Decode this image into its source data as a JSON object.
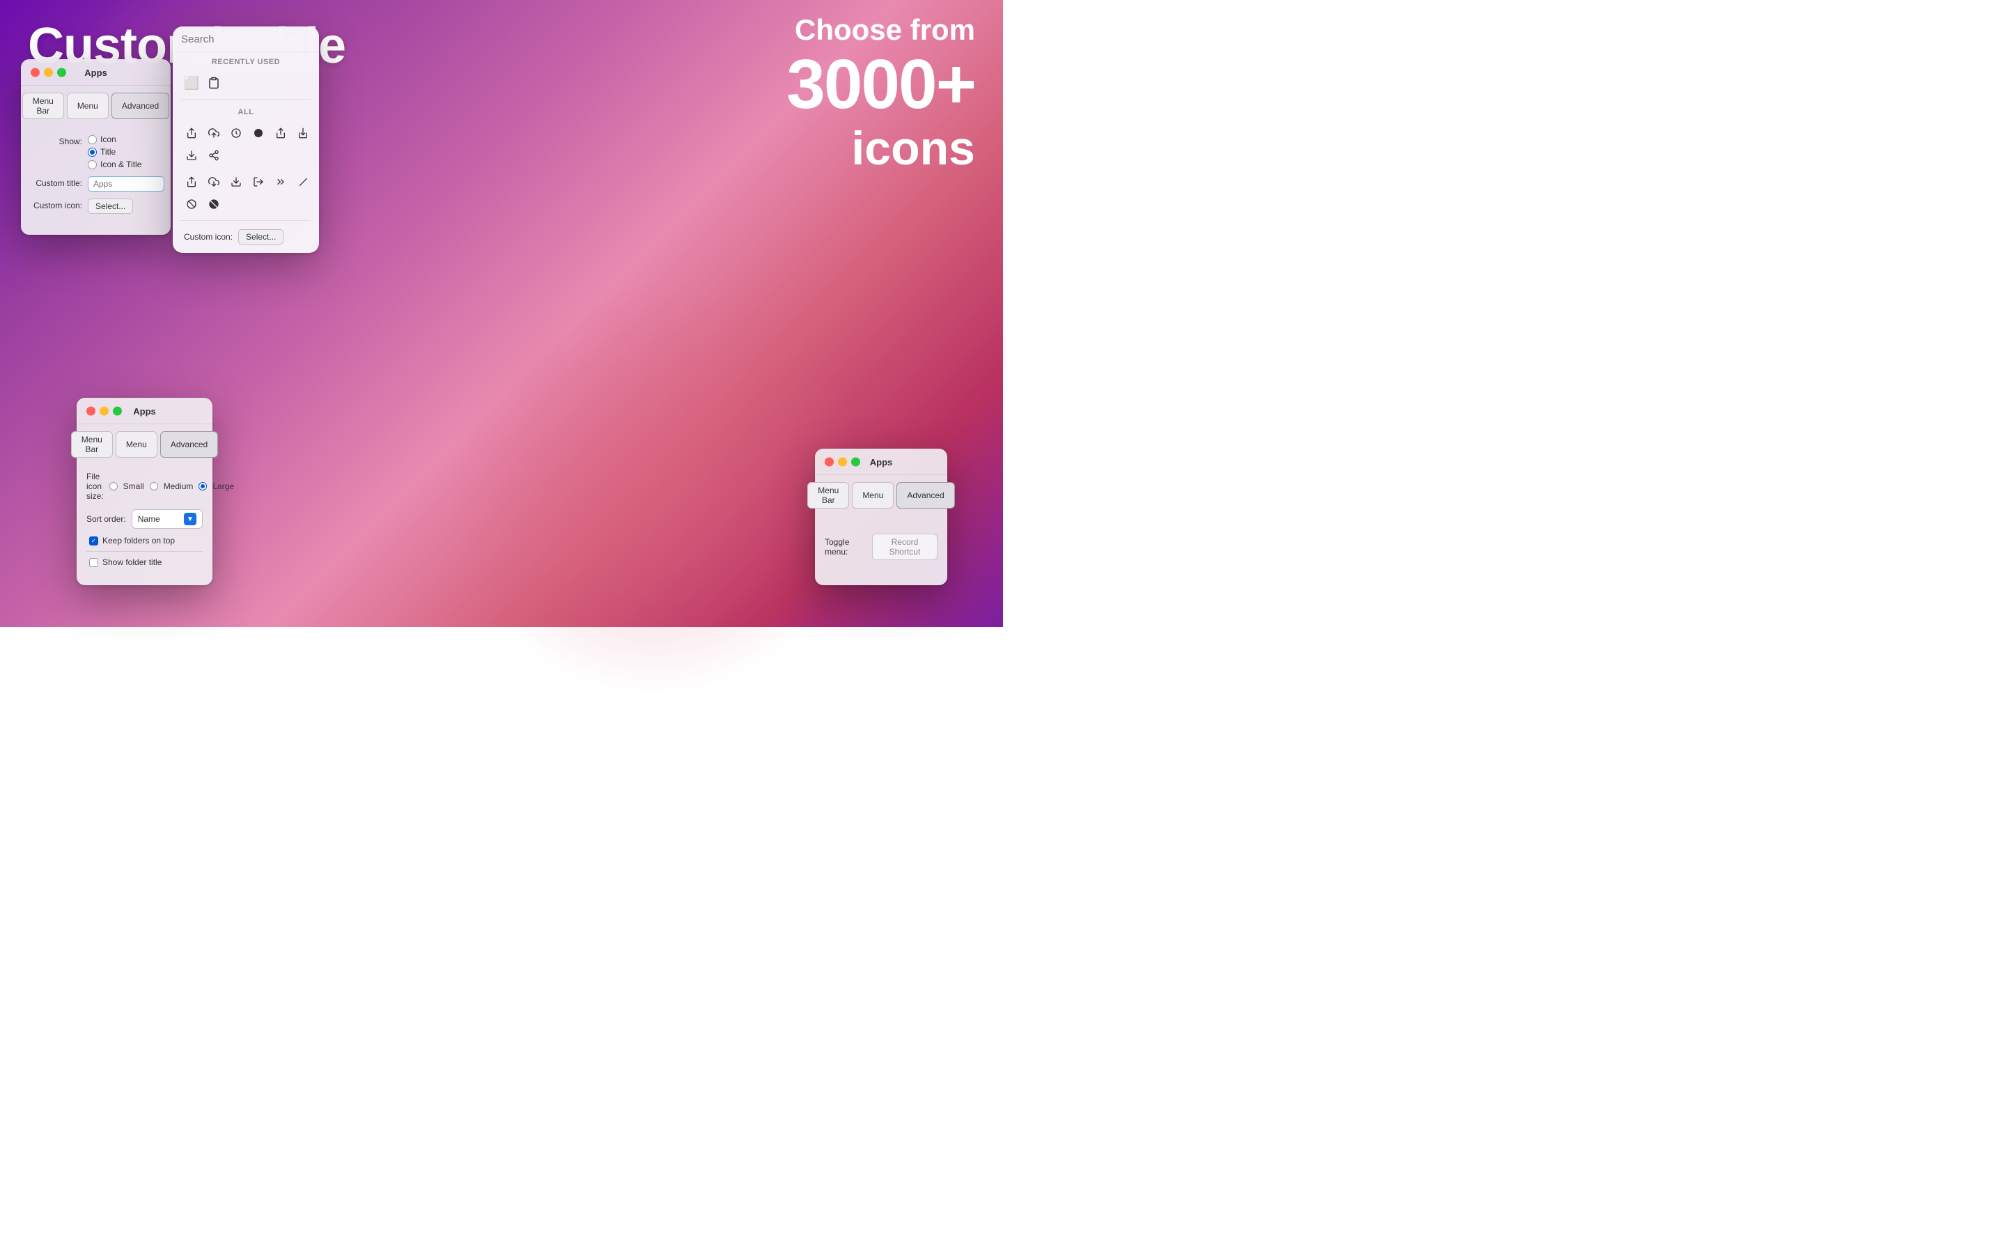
{
  "background": {
    "gradient": "linear-gradient(135deg, #6a0dad, #c865a8, #e88ab0, #d4607a, #7b1fa2)"
  },
  "heading_customizable": "Customizable",
  "heading_choose": {
    "line1": "Choose from",
    "line2": "3000+",
    "line3": "icons"
  },
  "window1": {
    "title": "Apps",
    "tabs": [
      "Menu Bar",
      "Menu",
      "Advanced"
    ],
    "active_tab": "Menu Bar",
    "show_label": "Show:",
    "show_options": [
      "Icon",
      "Title",
      "Icon & Title"
    ],
    "show_selected": "Title",
    "custom_title_label": "Custom title:",
    "custom_title_placeholder": "Apps",
    "custom_icon_label": "Custom icon:",
    "select_btn": "Select..."
  },
  "icon_picker": {
    "search_placeholder": "Search",
    "recently_used_label": "RECENTLY USED",
    "all_label": "ALL",
    "custom_icon_label": "Custom icon:",
    "select_btn": "Select...",
    "recently_used_icons": [
      "□",
      "📋"
    ],
    "all_icons_row1": [
      "⬆",
      "⬆",
      "🔃",
      "⬤",
      "⬆",
      "⬇",
      "⬇",
      "⬆"
    ],
    "all_icons_row2": [
      "⬆",
      "⬇",
      "⬇",
      "➡",
      "➡",
      "╱",
      "⊘",
      "⊘"
    ]
  },
  "window2": {
    "title": "Apps",
    "tabs": [
      "Menu Bar",
      "Menu",
      "Advanced"
    ],
    "active_tab": "Advanced",
    "file_icon_size_label": "File icon size:",
    "size_options": [
      "Small",
      "Medium",
      "Large"
    ],
    "size_selected": "Large",
    "sort_order_label": "Sort order:",
    "sort_value": "Name",
    "keep_folders_top_label": "Keep folders on top",
    "keep_folders_checked": true,
    "show_folder_title_label": "Show folder title",
    "show_folder_checked": false
  },
  "window3": {
    "title": "Apps",
    "tabs": [
      "Menu Bar",
      "Menu",
      "Advanced"
    ],
    "active_tab": "Advanced",
    "toggle_menu_label": "Toggle menu:",
    "record_shortcut_btn": "Record Shortcut"
  },
  "traffic_light": {
    "red": "#ff5f57",
    "yellow": "#febc2e",
    "green": "#28c840"
  }
}
